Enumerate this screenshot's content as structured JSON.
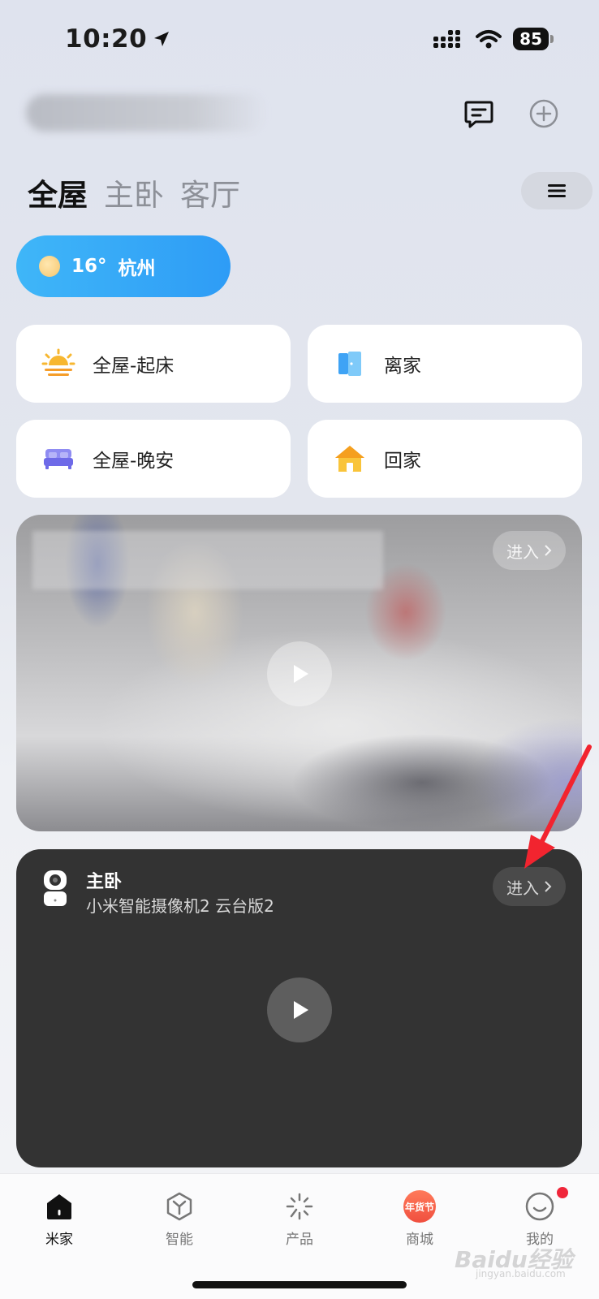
{
  "status_bar": {
    "time": "10:20",
    "battery": "85"
  },
  "header": {
    "home_name": ""
  },
  "tabs": [
    {
      "label": "全屋",
      "active": true
    },
    {
      "label": "主卧",
      "active": false
    },
    {
      "label": "客厅",
      "active": false
    }
  ],
  "weather": {
    "temperature": "16°",
    "city": "杭州"
  },
  "scenes": [
    {
      "label": "全屋-起床",
      "icon": "sunrise-icon"
    },
    {
      "label": "离家",
      "icon": "door-icon"
    },
    {
      "label": "全屋-晚安",
      "icon": "bed-icon"
    },
    {
      "label": "回家",
      "icon": "house-icon"
    }
  ],
  "camera_cards": [
    {
      "enter_label": "进入"
    },
    {
      "room": "主卧",
      "model": "小米智能摄像机2 云台版2",
      "enter_label": "进入"
    }
  ],
  "bottom_nav": [
    {
      "label": "米家",
      "icon": "home-icon",
      "active": true
    },
    {
      "label": "智能",
      "icon": "smart-cube-icon",
      "active": false
    },
    {
      "label": "产品",
      "icon": "product-sparkle-icon",
      "active": false
    },
    {
      "label": "商城",
      "icon": "festival-badge-icon",
      "badge_text": "年货节",
      "active": false
    },
    {
      "label": "我的",
      "icon": "profile-smile-icon",
      "active": false,
      "notification_dot": true
    }
  ],
  "watermark": {
    "text": "Baidu经验",
    "sub": "jingyan.baidu.com"
  },
  "colors": {
    "weather_pill": "#3aaef7",
    "accent_red": "#f0263a",
    "camera_dark": "#333333"
  }
}
